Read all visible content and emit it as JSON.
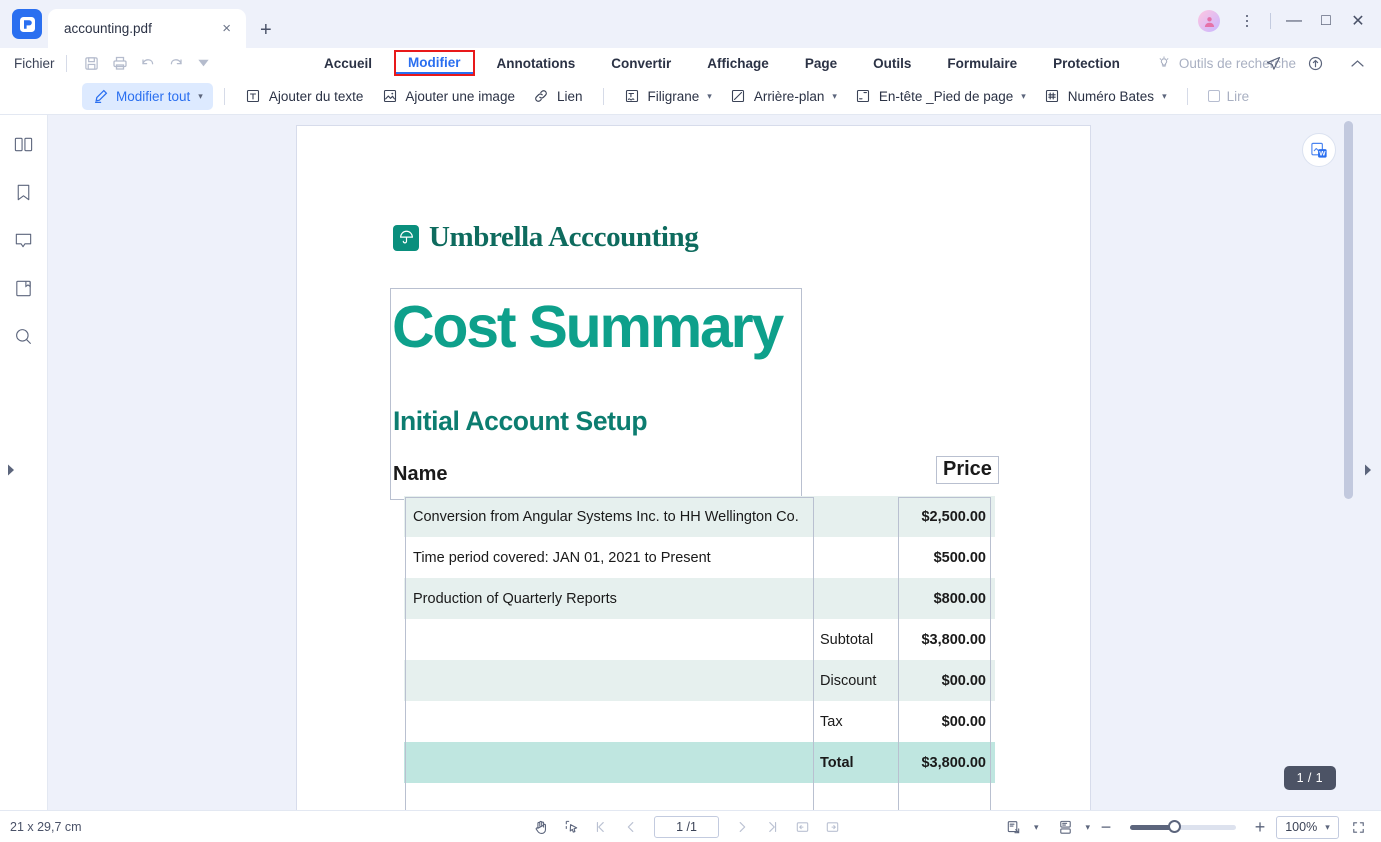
{
  "titlebar": {
    "app_icon": "pdfelement-logo-icon",
    "tab_title": "accounting.pdf",
    "tab_close_label": "×",
    "new_tab_label": "+",
    "avatar_icon": "user-avatar-icon",
    "more_icon": "more-vertical-icon",
    "minimize_label": "—",
    "maximize_label": "□",
    "close_label": "✕"
  },
  "menubar": {
    "file_label": "Fichier",
    "quick_icons": [
      "save-icon",
      "print-icon",
      "undo-icon",
      "redo-icon",
      "customize-toolbar-icon"
    ],
    "tabs": [
      {
        "label": "Accueil",
        "active": false
      },
      {
        "label": "Modifier",
        "active": true
      },
      {
        "label": "Annotations",
        "active": false
      },
      {
        "label": "Convertir",
        "active": false
      },
      {
        "label": "Affichage",
        "active": false
      },
      {
        "label": "Page",
        "active": false
      },
      {
        "label": "Outils",
        "active": false
      },
      {
        "label": "Formulaire",
        "active": false
      },
      {
        "label": "Protection",
        "active": false
      }
    ],
    "search_tools_label": "Outils de recherche",
    "search_tools_icon": "lightbulb-icon",
    "right_icons": [
      "send-icon",
      "cloud-upload-icon",
      "collapse-ribbon-icon"
    ]
  },
  "ribbon": {
    "edit_all_label": "Modifier tout",
    "edit_all_icon": "pencil-icon",
    "items": [
      {
        "label": "Ajouter du texte",
        "icon": "add-text-icon",
        "caret": false
      },
      {
        "label": "Ajouter une image",
        "icon": "add-image-icon",
        "caret": false
      },
      {
        "label": "Lien",
        "icon": "link-icon",
        "caret": false
      },
      {
        "label": "Filigrane",
        "icon": "watermark-icon",
        "caret": true
      },
      {
        "label": "Arrière-plan",
        "icon": "background-icon",
        "caret": true
      },
      {
        "label": "En-tête _Pied de page",
        "icon": "header-footer-icon",
        "caret": true
      },
      {
        "label": "Numéro Bates",
        "icon": "bates-number-icon",
        "caret": true
      }
    ],
    "read_label": "Lire",
    "read_checked": false
  },
  "left_rail": {
    "items": [
      {
        "icon": "thumbnails-panel-icon",
        "name": "sidebar-thumbnails"
      },
      {
        "icon": "bookmark-icon",
        "name": "sidebar-bookmarks"
      },
      {
        "icon": "comment-icon",
        "name": "sidebar-comments"
      },
      {
        "icon": "attachment-page-icon",
        "name": "sidebar-attachments"
      },
      {
        "icon": "search-icon",
        "name": "sidebar-search"
      }
    ],
    "expand_arrow_icon": "chevron-right-icon"
  },
  "viewer": {
    "word_convert_icon": "convert-to-word-icon",
    "page_badge": "1 / 1",
    "panel_arrow_icon": "chevron-right-icon",
    "scrollbar": "vertical-scrollbar"
  },
  "document": {
    "brand_mark_icon": "umbrella-icon",
    "brand_name": "Umbrella Acccounting",
    "heading": "Cost Summary",
    "subheading": "Initial Account Setup",
    "col_name_header": "Name",
    "col_price_header": "Price",
    "rows": [
      {
        "name": "Conversion from Angular Systems Inc. to HH Wellington Co.",
        "mid": "",
        "price": "$2,500.00",
        "style": "alt"
      },
      {
        "name": "Time period covered: JAN 01, 2021 to Present",
        "mid": "",
        "price": "$500.00",
        "style": "plain"
      },
      {
        "name": "Production of Quarterly Reports",
        "mid": "",
        "price": "$800.00",
        "style": "alt"
      },
      {
        "name": "",
        "mid": "Subtotal",
        "price": "$3,800.00",
        "style": "plain"
      },
      {
        "name": "",
        "mid": "Discount",
        "price": "$00.00",
        "style": "alt"
      },
      {
        "name": "",
        "mid": "Tax",
        "price": "$00.00",
        "style": "plain"
      },
      {
        "name": "",
        "mid": "Total",
        "price": "$3,800.00",
        "style": "total"
      }
    ]
  },
  "statusbar": {
    "page_size": "21 x 29,7 cm",
    "hand_tool_icon": "hand-tool-icon",
    "select_tool_icon": "select-tool-icon",
    "first_page_icon": "first-page-icon",
    "prev_page_icon": "prev-page-icon",
    "page_value": "1 /1",
    "next_page_icon": "next-page-icon",
    "last_page_icon": "last-page-icon",
    "fit_prev_icon": "page-left-icon",
    "fit_next_icon": "page-right-icon",
    "view_mode_icon": "fit-page-icon",
    "layout_mode_icon": "page-layout-icon",
    "zoom_out_label": "−",
    "zoom_in_label": "+",
    "zoom_value": "100%",
    "fullscreen_icon": "fullscreen-icon"
  },
  "colors": {
    "accent_blue": "#2a6ff0",
    "highlight_red": "#e8191a",
    "doc_teal": "#0ea08b",
    "doc_teal_dark": "#0c7d70",
    "row_alt": "#e6f0ee",
    "row_total": "#bfe6e0"
  }
}
